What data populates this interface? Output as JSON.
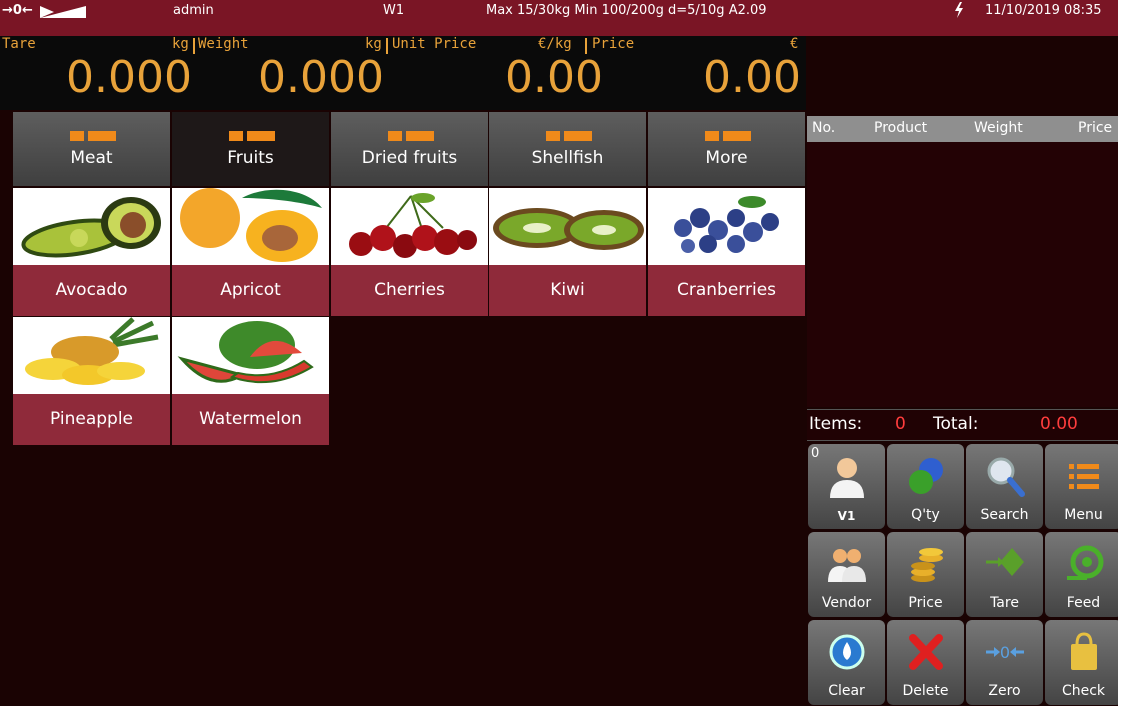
{
  "status": {
    "indicators": "→0←",
    "user": "admin",
    "scale": "W1",
    "spec": "Max 15/30kg  Min 100/200g d=5/10g A2.09",
    "power_icon": "power-icon",
    "datetime": "11/10/2019 08:35"
  },
  "display": {
    "tare_label": "Tare",
    "tare_unit": "kg",
    "tare_value": "0.000",
    "weight_label": "Weight",
    "weight_unit": "kg",
    "weight_value": "0.000",
    "unit_price_label": "Unit Price",
    "unit_price_unit": "€/kg",
    "unit_price_value": "0.00",
    "price_label": "Price",
    "price_unit": "€",
    "price_value": "0.00"
  },
  "categories": [
    {
      "label": "Meat",
      "active": false
    },
    {
      "label": "Fruits",
      "active": true
    },
    {
      "label": "Dried fruits",
      "active": false
    },
    {
      "label": "Shellfish",
      "active": false
    },
    {
      "label": "More",
      "active": false
    }
  ],
  "products": [
    {
      "name": "Avocado",
      "icon": "avocado-image"
    },
    {
      "name": "Apricot",
      "icon": "apricot-image"
    },
    {
      "name": "Cherries",
      "icon": "cherries-image"
    },
    {
      "name": "Kiwi",
      "icon": "kiwi-image"
    },
    {
      "name": "Cranberries",
      "icon": "cranberries-image"
    },
    {
      "name": "Pineapple",
      "icon": "pineapple-image"
    },
    {
      "name": "Watermelon",
      "icon": "watermelon-image"
    }
  ],
  "order": {
    "columns": [
      "No.",
      "Product",
      "Weight",
      "Price"
    ],
    "items_label": "Items:",
    "items_count": "0",
    "total_label": "Total:",
    "total_value": "0.00"
  },
  "keys": {
    "vendor_badge": "0",
    "v1": "V1",
    "qty": "Q'ty",
    "search": "Search",
    "menu": "Menu",
    "vendor": "Vendor",
    "price": "Price",
    "tare": "Tare",
    "feed": "Feed",
    "clear": "Clear",
    "delete": "Delete",
    "zero": "Zero",
    "check": "Check"
  }
}
